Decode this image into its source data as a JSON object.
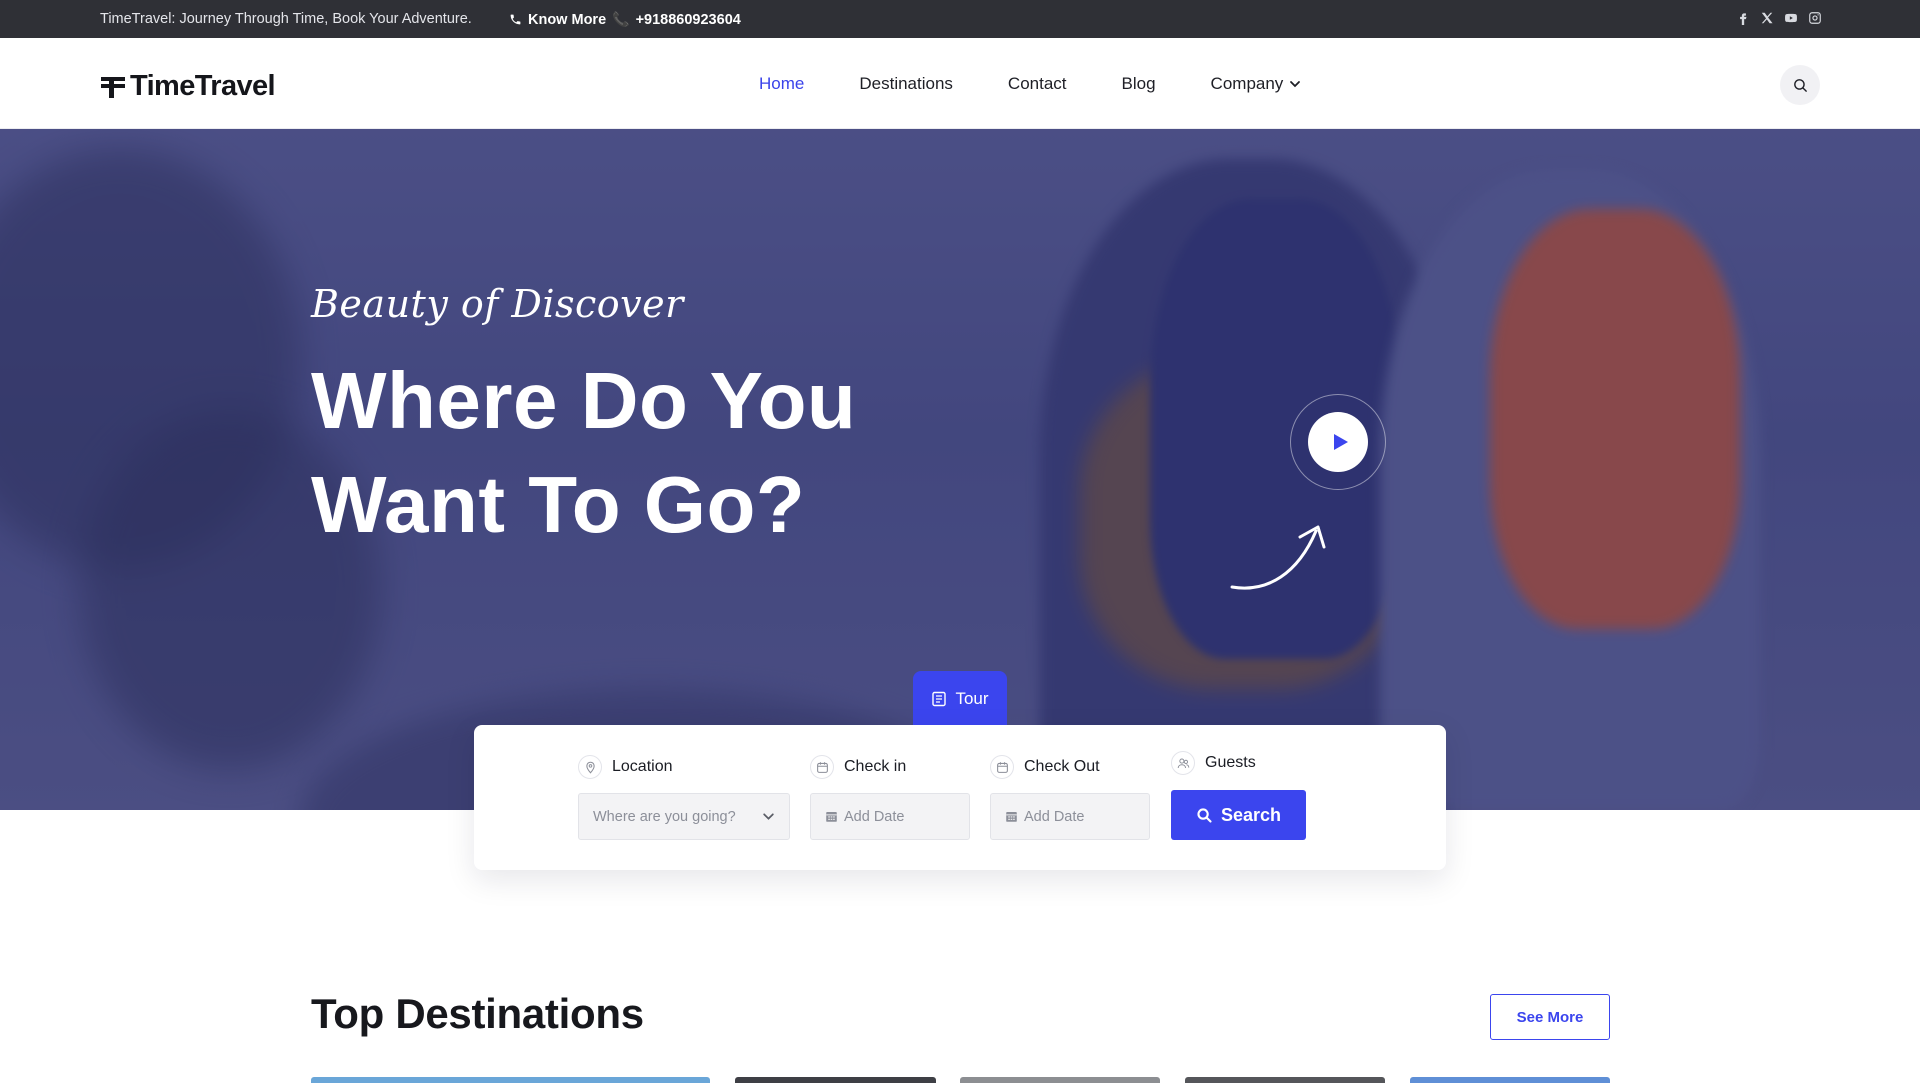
{
  "topbar": {
    "tagline": "TimeTravel: Journey Through Time, Book Your Adventure.",
    "know_more": "Know More",
    "phone_emoji": "📞",
    "phone": "+918860923604",
    "social": [
      "facebook-icon",
      "x-twitter-icon",
      "youtube-icon",
      "instagram-icon"
    ]
  },
  "header": {
    "logo_text": "TimeTravel",
    "nav": [
      {
        "label": "Home",
        "active": true
      },
      {
        "label": "Destinations",
        "active": false
      },
      {
        "label": "Contact",
        "active": false
      },
      {
        "label": "Blog",
        "active": false
      },
      {
        "label": "Company",
        "active": false,
        "has_dropdown": true
      }
    ]
  },
  "hero": {
    "eyebrow": "Beauty of Discover",
    "title": "Where Do You Want To Go?"
  },
  "search": {
    "tab_label": "Tour",
    "location_label": "Location",
    "location_placeholder": "Where are you going?",
    "checkin_label": "Check in",
    "checkin_placeholder": "Add Date",
    "checkout_label": "Check Out",
    "checkout_placeholder": "Add Date",
    "guests_label": "Guests",
    "button_label": "Search"
  },
  "destinations": {
    "title": "Top Destinations",
    "see_more": "See More"
  },
  "colors": {
    "accent": "#3b45ee",
    "topbar_bg": "#2f3036",
    "hero_tint": "#4e5388"
  }
}
